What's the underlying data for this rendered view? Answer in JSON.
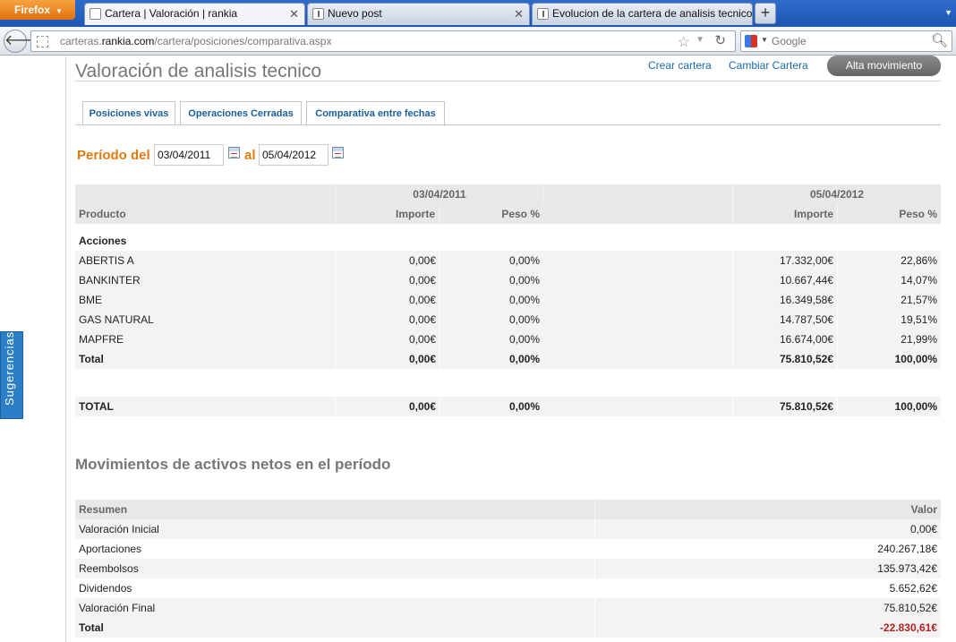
{
  "browser": {
    "menu_label": "Firefox",
    "tabs": [
      {
        "title": "Cartera | Valoración | rankia",
        "active": true
      },
      {
        "title": "Nuevo post",
        "active": false
      },
      {
        "title": "Evolucion de la cartera de analisis tecnico.",
        "active": false
      }
    ],
    "url_prefix": "carteras.",
    "url_domain": "rankia.com",
    "url_path": "/cartera/posiciones/comparativa.aspx",
    "search_placeholder": "Google"
  },
  "sidebar": {
    "feedback_label": "Sugerencias"
  },
  "header": {
    "title": "Valoración de analisis tecnico",
    "crear_cartera": "Crear cartera",
    "cambiar_cartera": "Cambiar Cartera",
    "alta_movimiento": "Alta movimiento"
  },
  "tabs": [
    "Posiciones vivas",
    "Operaciones Cerradas",
    "Comparativa entre fechas"
  ],
  "period": {
    "label_from": "Período del",
    "date_from": "03/04/2011",
    "label_to": "al",
    "date_to": "05/04/2012"
  },
  "positions_table": {
    "date1": "03/04/2011",
    "date2": "05/04/2012",
    "col_producto": "Producto",
    "col_importe": "Importe",
    "col_peso": "Peso %",
    "group_label": "Acciones",
    "rows": [
      {
        "name": "ABERTIS A",
        "imp1": "0,00€",
        "peso1": "0,00%",
        "imp2": "17.332,00€",
        "peso2": "22,86%"
      },
      {
        "name": "BANKINTER",
        "imp1": "0,00€",
        "peso1": "0,00%",
        "imp2": "10.667,44€",
        "peso2": "14,07%"
      },
      {
        "name": "BME",
        "imp1": "0,00€",
        "peso1": "0,00%",
        "imp2": "16.349,58€",
        "peso2": "21,57%"
      },
      {
        "name": "GAS NATURAL",
        "imp1": "0,00€",
        "peso1": "0,00%",
        "imp2": "14.787,50€",
        "peso2": "19,51%"
      },
      {
        "name": "MAPFRE",
        "imp1": "0,00€",
        "peso1": "0,00%",
        "imp2": "16.674,00€",
        "peso2": "21,99%"
      }
    ],
    "subtotal": {
      "name": "Total",
      "imp1": "0,00€",
      "peso1": "0,00%",
      "imp2": "75.810,52€",
      "peso2": "100,00%"
    },
    "grand_total": {
      "name": "TOTAL",
      "imp1": "0,00€",
      "peso1": "0,00%",
      "imp2": "75.810,52€",
      "peso2": "100,00%"
    }
  },
  "movements": {
    "title": "Movimientos de activos netos en el período",
    "col_resumen": "Resumen",
    "col_valor": "Valor",
    "rows": [
      {
        "label": "Valoración Inicial",
        "value": "0,00€"
      },
      {
        "label": "Aportaciones",
        "value": "240.267,18€"
      },
      {
        "label": "Reembolsos",
        "value": "135.973,42€"
      },
      {
        "label": "Dividendos",
        "value": "5.652,62€"
      },
      {
        "label": "Valoración Final",
        "value": "75.810,52€"
      }
    ],
    "total": {
      "label": "Total",
      "value": "-22.830,61€"
    }
  },
  "colors": {
    "accent_orange": "#e07a10",
    "link_blue": "#1a6aa8",
    "negative_red": "#b22222"
  }
}
